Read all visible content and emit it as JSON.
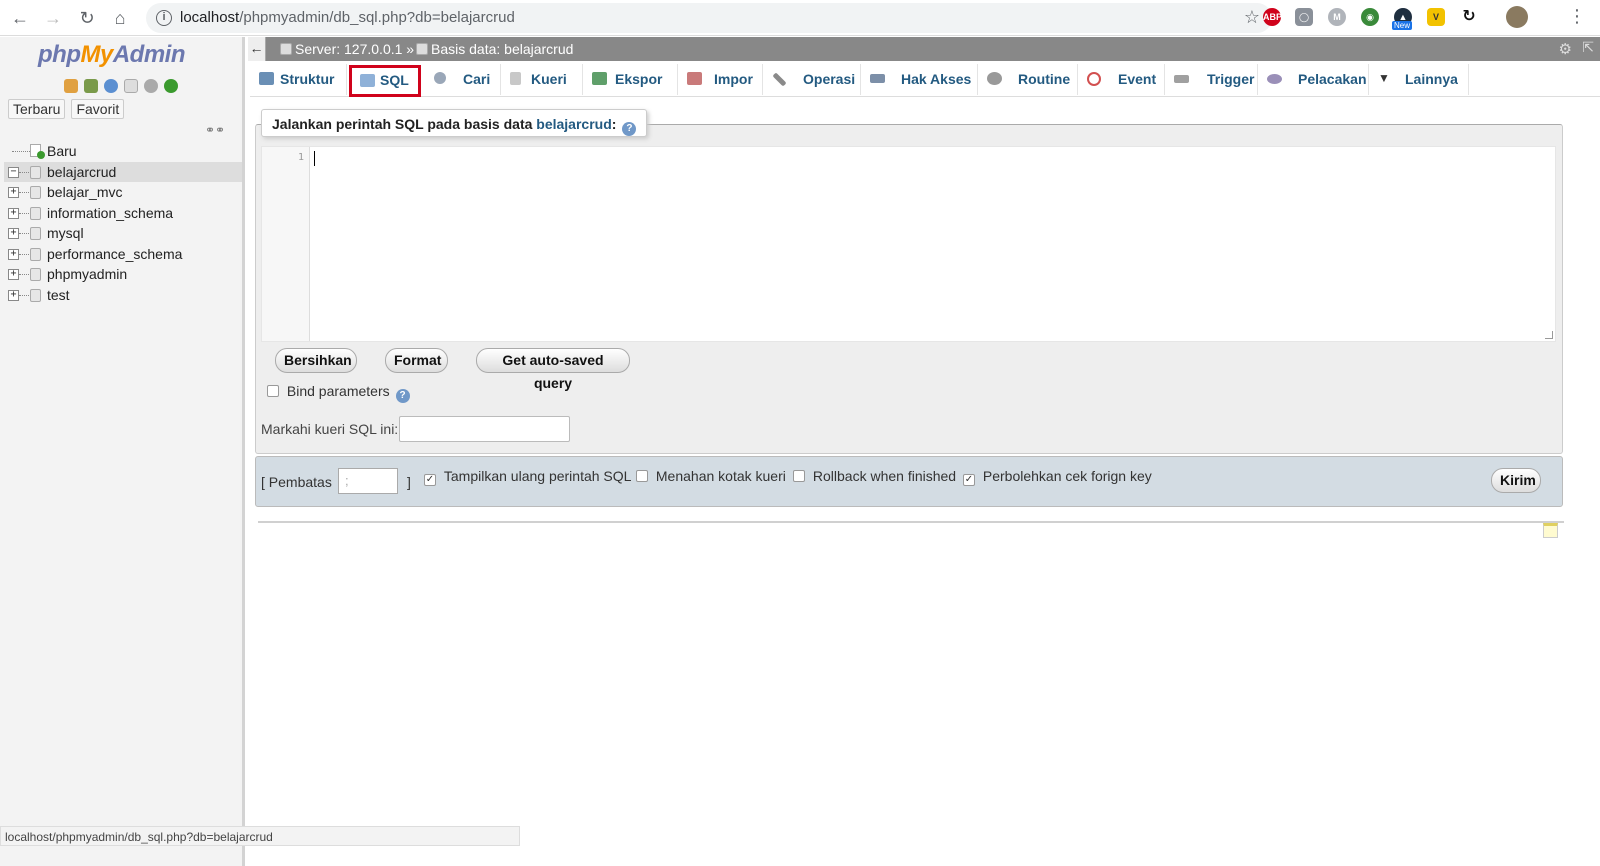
{
  "browser": {
    "url_host": "localhost",
    "url_path": "/phpmyadmin/db_sql.php?db=belajarcrud",
    "ext_new_badge": "New"
  },
  "sidebar": {
    "logo": {
      "php": "php",
      "my": "My",
      "admin": "Admin"
    },
    "tabs": [
      "Terbaru",
      "Favorit"
    ],
    "tree": [
      {
        "label": "Baru",
        "type": "new"
      },
      {
        "label": "belajarcrud",
        "type": "db",
        "expanded": true,
        "selected": true
      },
      {
        "label": "belajar_mvc",
        "type": "db"
      },
      {
        "label": "information_schema",
        "type": "db"
      },
      {
        "label": "mysql",
        "type": "db"
      },
      {
        "label": "performance_schema",
        "type": "db"
      },
      {
        "label": "phpmyadmin",
        "type": "db"
      },
      {
        "label": "test",
        "type": "db"
      }
    ]
  },
  "breadcrumb": {
    "server": "Server: 127.0.0.1 »",
    "database": "Basis data: belajarcrud"
  },
  "tabs": [
    {
      "label": "Struktur",
      "icon": "structure-icon",
      "color": "#6a8fb5"
    },
    {
      "label": "SQL",
      "icon": "sql-icon",
      "color": "#8fb1d8",
      "active": true
    },
    {
      "label": "Cari",
      "icon": "search-icon",
      "color": "#9aa7b8"
    },
    {
      "label": "Kueri",
      "icon": "query-icon",
      "color": "#c8c8c8"
    },
    {
      "label": "Ekspor",
      "icon": "export-icon",
      "color": "#5f9f6a"
    },
    {
      "label": "Impor",
      "icon": "import-icon",
      "color": "#c97a7a"
    },
    {
      "label": "Operasi",
      "icon": "wrench-icon",
      "color": "#8a8a8a"
    },
    {
      "label": "Hak Akses",
      "icon": "privileges-icon",
      "color": "#7c8fa8"
    },
    {
      "label": "Routine",
      "icon": "routine-icon",
      "color": "#999999"
    },
    {
      "label": "Event",
      "icon": "clock-icon",
      "color": "#d25050"
    },
    {
      "label": "Trigger",
      "icon": "trigger-icon",
      "color": "#a0a0a0"
    },
    {
      "label": "Pelacakan",
      "icon": "eye-icon",
      "color": "#9a8fb8"
    },
    {
      "label": "Lainnya",
      "icon": "chevron-down-icon",
      "color": "#333333"
    }
  ],
  "sql_panel": {
    "legend_prefix": "Jalankan perintah SQL pada basis data",
    "legend_db": "belajarcrud",
    "legend_suffix": ":",
    "line_number": "1",
    "buttons": {
      "clear": "Bersihkan",
      "format": "Format",
      "autosave": "Get auto-saved query"
    },
    "bind_parameters": "Bind parameters",
    "bookmark_label": "Markahi kueri SQL ini:",
    "bookmark_value": ""
  },
  "options": {
    "delimiter_label": "[ Pembatas",
    "delimiter_value": ";",
    "delimiter_close": "]",
    "show_query": {
      "label": "Tampilkan ulang perintah SQL",
      "checked": true
    },
    "retain_box": {
      "label": "Menahan kotak kueri",
      "checked": false
    },
    "rollback": {
      "label": "Rollback when finished",
      "checked": false
    },
    "foreign_key": {
      "label": "Perbolehkan cek forign key",
      "checked": true
    },
    "submit": "Kirim"
  },
  "status_bar": "localhost/phpmyadmin/db_sql.php?db=belajarcrud"
}
